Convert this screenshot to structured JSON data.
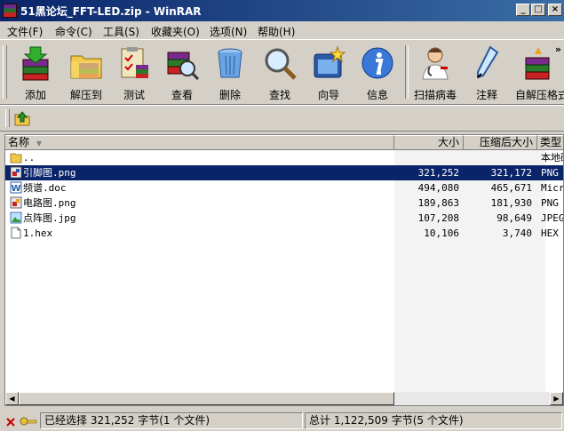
{
  "window": {
    "title": "51黑论坛_FFT-LED.zip - WinRAR",
    "buttons": {
      "minimize": "_",
      "maximize": "□",
      "close": "×"
    }
  },
  "menu": [
    "文件(F)",
    "命令(C)",
    "工具(S)",
    "收藏夹(O)",
    "选项(N)",
    "帮助(H)"
  ],
  "toolbar": {
    "buttons": [
      {
        "label": "添加",
        "icon": "add-books-icon"
      },
      {
        "label": "解压到",
        "icon": "extract-folder-icon"
      },
      {
        "label": "测试",
        "icon": "test-clipboard-icon"
      },
      {
        "label": "查看",
        "icon": "view-books-icon"
      },
      {
        "label": "删除",
        "icon": "recycle-bin-icon"
      },
      {
        "label": "查找",
        "icon": "magnifier-icon"
      },
      {
        "label": "向导",
        "icon": "wizard-icon"
      },
      {
        "label": "信息",
        "icon": "info-icon"
      },
      {
        "label": "扫描病毒",
        "icon": "doctor-icon"
      },
      {
        "label": "注释",
        "icon": "pen-icon"
      },
      {
        "label": "自解压格式",
        "icon": "sfx-icon"
      }
    ],
    "more": "»"
  },
  "columns": {
    "name": "名称",
    "size": "大小",
    "packed": "压缩后大小",
    "type": "类型"
  },
  "files": [
    {
      "name": "..",
      "size": "",
      "packed": "",
      "type": "本地磁盘",
      "icon": "folder-up-icon"
    },
    {
      "name": "引脚图.png",
      "size": "321,252",
      "packed": "321,172",
      "type": "PNG 图像",
      "icon": "png-file-icon",
      "selected": true
    },
    {
      "name": "频谱.doc",
      "size": "494,080",
      "packed": "465,671",
      "type": "Microsoft Word",
      "icon": "doc-file-icon"
    },
    {
      "name": "电路图.png",
      "size": "189,863",
      "packed": "181,930",
      "type": "PNG 图像",
      "icon": "png-file-icon"
    },
    {
      "name": "点阵图.jpg",
      "size": "107,208",
      "packed": "98,649",
      "type": "JPEG 图像",
      "icon": "jpg-file-icon"
    },
    {
      "name": "1.hex",
      "size": "10,106",
      "packed": "3,740",
      "type": "HEX 文件",
      "icon": "blank-file-icon"
    }
  ],
  "status": {
    "selected": "已经选择 321,252 字节(1 个文件)",
    "total": "总计 1,122,509 字节(5 个文件)"
  }
}
